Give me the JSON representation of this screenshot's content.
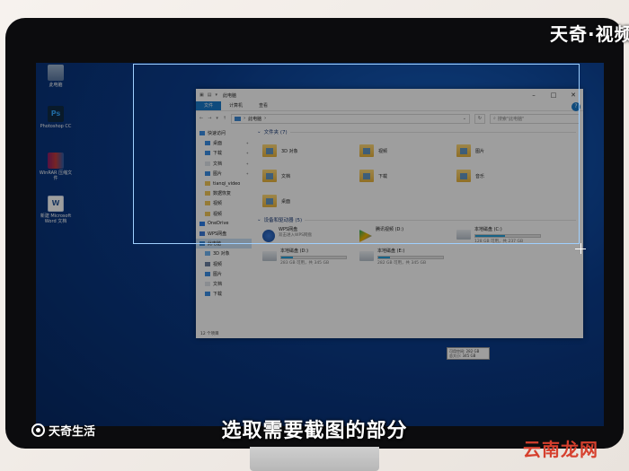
{
  "overlay": {
    "subtitle": "选取需要截图的部分",
    "bottom_left_logo": "天奇生活",
    "top_right_brand": "天奇·视频",
    "bottom_right_watermark": "云南龙网"
  },
  "desktop": {
    "icons": [
      {
        "label": "此电脑",
        "icon": "pc-icon"
      },
      {
        "label": "Photoshop CC",
        "icon": "photoshop-icon"
      },
      {
        "label": "WinRAR 压缩文件",
        "icon": "winrar-icon"
      },
      {
        "label": "新建 Microsoft Word 文档",
        "icon": "word-doc-icon"
      }
    ]
  },
  "explorer": {
    "title": "此电脑",
    "ribbon_tabs": [
      "文件",
      "计算机",
      "查看"
    ],
    "address": "此电脑",
    "search_placeholder": "搜索\"此电脑\"",
    "nav": [
      {
        "label": "快速访问",
        "group": true,
        "pinned": false,
        "color": "#3a8ee6"
      },
      {
        "label": "桌面",
        "group": false,
        "pinned": true,
        "color": "#3a8ee6"
      },
      {
        "label": "下载",
        "group": false,
        "pinned": true,
        "color": "#3a8ee6"
      },
      {
        "label": "文档",
        "group": false,
        "pinned": true,
        "color": "#dfe4ea"
      },
      {
        "label": "图片",
        "group": false,
        "pinned": true,
        "color": "#3a8ee6"
      },
      {
        "label": "tianqi_video",
        "group": false,
        "pinned": false,
        "color": "#f0c75a"
      },
      {
        "label": "数据恢复",
        "group": false,
        "pinned": false,
        "color": "#f0c75a"
      },
      {
        "label": "视频",
        "group": false,
        "pinned": false,
        "color": "#f0c75a"
      },
      {
        "label": "视频",
        "group": false,
        "pinned": false,
        "color": "#f0c75a"
      },
      {
        "label": "OneDrive",
        "group": true,
        "pinned": false,
        "color": "#2b7de9"
      },
      {
        "label": "WPS网盘",
        "group": true,
        "pinned": false,
        "color": "#3b7ad9"
      },
      {
        "label": "此电脑",
        "group": true,
        "pinned": false,
        "color": "#3c8ad6",
        "selected": true
      },
      {
        "label": "3D 对象",
        "group": false,
        "pinned": false,
        "color": "#6fb3f0"
      },
      {
        "label": "视频",
        "group": false,
        "pinned": false,
        "color": "#6a7ea0"
      },
      {
        "label": "图片",
        "group": false,
        "pinned": false,
        "color": "#3a8ee6"
      },
      {
        "label": "文档",
        "group": false,
        "pinned": false,
        "color": "#dfe4ea"
      },
      {
        "label": "下载",
        "group": false,
        "pinned": false,
        "color": "#3a8ee6"
      }
    ],
    "folders_header": "文件夹 (7)",
    "folders": [
      "3D 对象",
      "视频",
      "图片",
      "文档",
      "下载",
      "音乐",
      "桌面"
    ],
    "devices_header": "设备和驱动器 (5)",
    "drives": [
      {
        "name": "WPS网盘",
        "size": "双击进入WPS网盘",
        "fill": 0,
        "type": "wps"
      },
      {
        "name": "腾讯视频 (D:)",
        "size": "",
        "fill": 0,
        "type": "media"
      },
      {
        "name": "本地磁盘 (C:)",
        "size": "128 GB 可用，共 237 GB",
        "fill": 0.46,
        "type": "disk"
      },
      {
        "name": "本地磁盘 (D:)",
        "size": "283 GB 可用，共 345 GB",
        "fill": 0.18,
        "type": "disk"
      },
      {
        "name": "本地磁盘 (E:)",
        "size": "282 GB 可用，共 345 GB",
        "fill": 0.18,
        "type": "disk"
      }
    ],
    "tooltip": "可用空间: 282 GB\n总大小: 345 GB",
    "status": "12 个项目"
  }
}
